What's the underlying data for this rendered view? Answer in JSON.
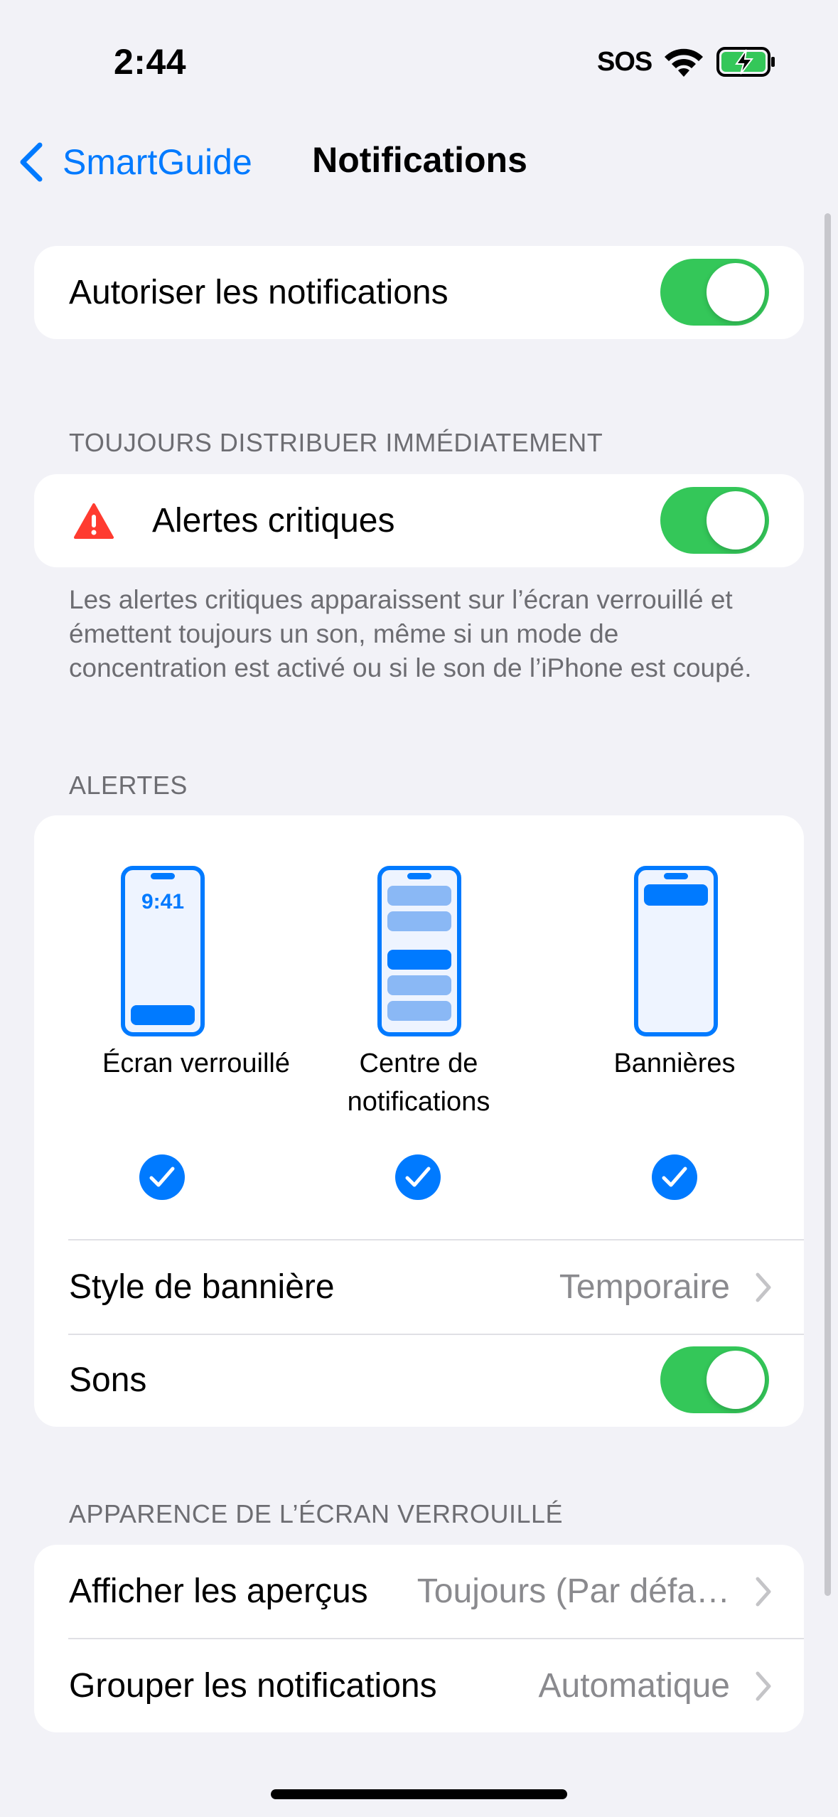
{
  "status_bar": {
    "time": "2:44",
    "sos": "SOS"
  },
  "nav": {
    "back_label": "SmartGuide",
    "title": "Notifications"
  },
  "allow_notifications": {
    "label": "Autoriser les notifications",
    "enabled": true
  },
  "critical": {
    "header": "TOUJOURS DISTRIBUER IMMÉDIATEMENT",
    "label": "Alertes critiques",
    "enabled": true,
    "footnote": "Les alertes critiques apparaissent sur l’écran verrouillé et émettent toujours un son, même si un mode de concentration est activé ou si le son de l’iPhone est coupé."
  },
  "alerts": {
    "header": "ALERTES",
    "previews": [
      {
        "caption": "Écran verrouillé",
        "clock": "9:41",
        "checked": true
      },
      {
        "caption_line1": "Centre de",
        "caption_line2": "notifications",
        "checked": true
      },
      {
        "caption": "Bannières",
        "checked": true
      }
    ],
    "banner_style": {
      "label": "Style de bannière",
      "value": "Temporaire"
    },
    "sounds": {
      "label": "Sons",
      "enabled": true
    }
  },
  "lock_screen": {
    "header": "APPARENCE DE L’ÉCRAN VERROUILLÉ",
    "show_previews": {
      "label": "Afficher les aperçus",
      "value": "Toujours (Par défa…"
    },
    "grouping": {
      "label": "Grouper les notifications",
      "value": "Automatique"
    }
  },
  "colors": {
    "accent": "#007aff",
    "toggle_on": "#34c759",
    "warning": "#ff3b30",
    "background": "#f2f2f7"
  }
}
